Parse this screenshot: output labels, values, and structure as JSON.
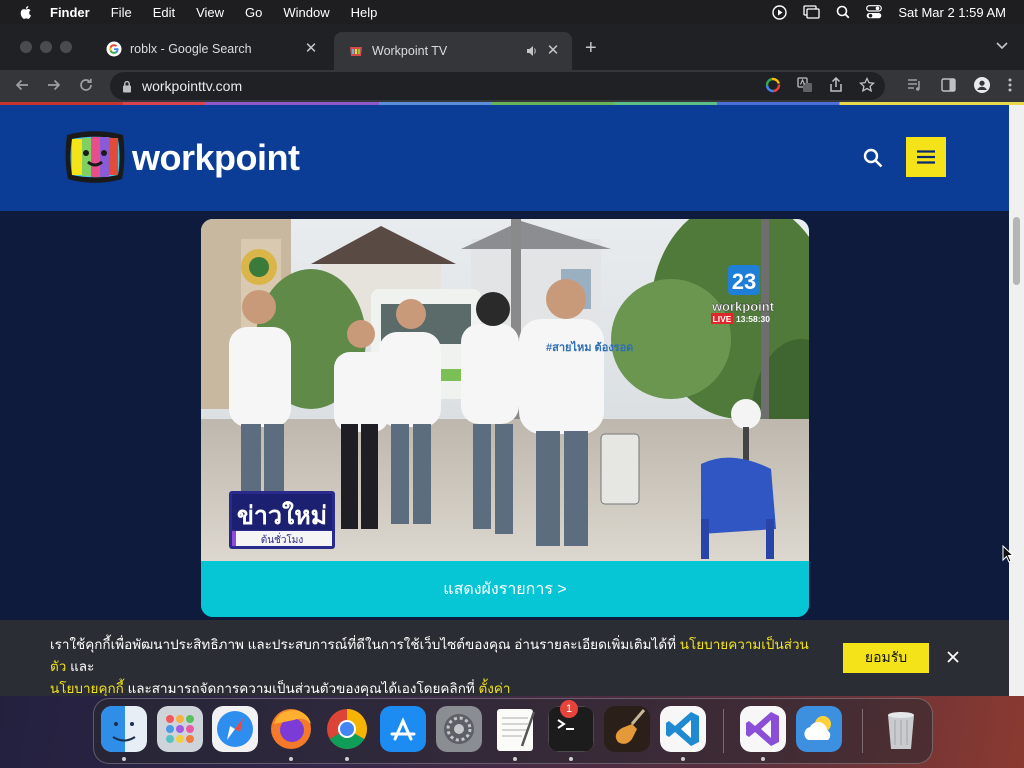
{
  "menubar": {
    "app_name": "Finder",
    "items": [
      "File",
      "Edit",
      "View",
      "Go",
      "Window",
      "Help"
    ],
    "clock": "Sat Mar 2  1:59 AM"
  },
  "browser": {
    "tabs": [
      {
        "title": "roblx - Google Search",
        "icon": "google-icon",
        "active": false
      },
      {
        "title": "Workpoint TV",
        "icon": "workpoint-favicon",
        "active": true,
        "audio": true
      }
    ],
    "url": "workpointtv.com"
  },
  "site": {
    "logo_text": "workpoint",
    "brand_color": "#0b3c96",
    "accent_color": "#f5e31a"
  },
  "video": {
    "channel_number": "23",
    "channel_name": "workpoint",
    "live_label": "LIVE",
    "live_time": "13:58:30",
    "show_title": "ข่าวใหม่",
    "show_subtitle": "ต้นชั่วโมง",
    "shirt_text": "#สายไหม ต้องรอด"
  },
  "schedule_button": "แสดงผังรายการ >",
  "cookie": {
    "text_1": "เราใช้คุกกี้เพื่อพัฒนาประสิทธิภาพ และประสบการณ์ที่ดีในการใช้เว็บไซต์ของคุณ อ่านรายละเอียดเพิ่มเติมได้ที่ ",
    "link_privacy": "นโยบายความเป็นส่วนตัว",
    "text_2": " และ",
    "link_cookie": "นโยบายคุกกี้",
    "text_3": " และสามารถจัดการความเป็นส่วนตัวของคุณได้เองโดยคลิกที่ ",
    "link_settings": "ตั้งค่า",
    "accept": "ยอมรับ"
  },
  "dock": {
    "apps": [
      "finder-icon",
      "launchpad-icon",
      "safari-icon",
      "firefox-icon",
      "chrome-icon",
      "app-store-icon",
      "system-preferences-icon",
      "textedit-icon",
      "terminal-icon",
      "garageband-icon",
      "vscode-icon",
      "visual-studio-icon",
      "weather-icon",
      "trash-icon"
    ],
    "system_preferences_badge": "1"
  }
}
